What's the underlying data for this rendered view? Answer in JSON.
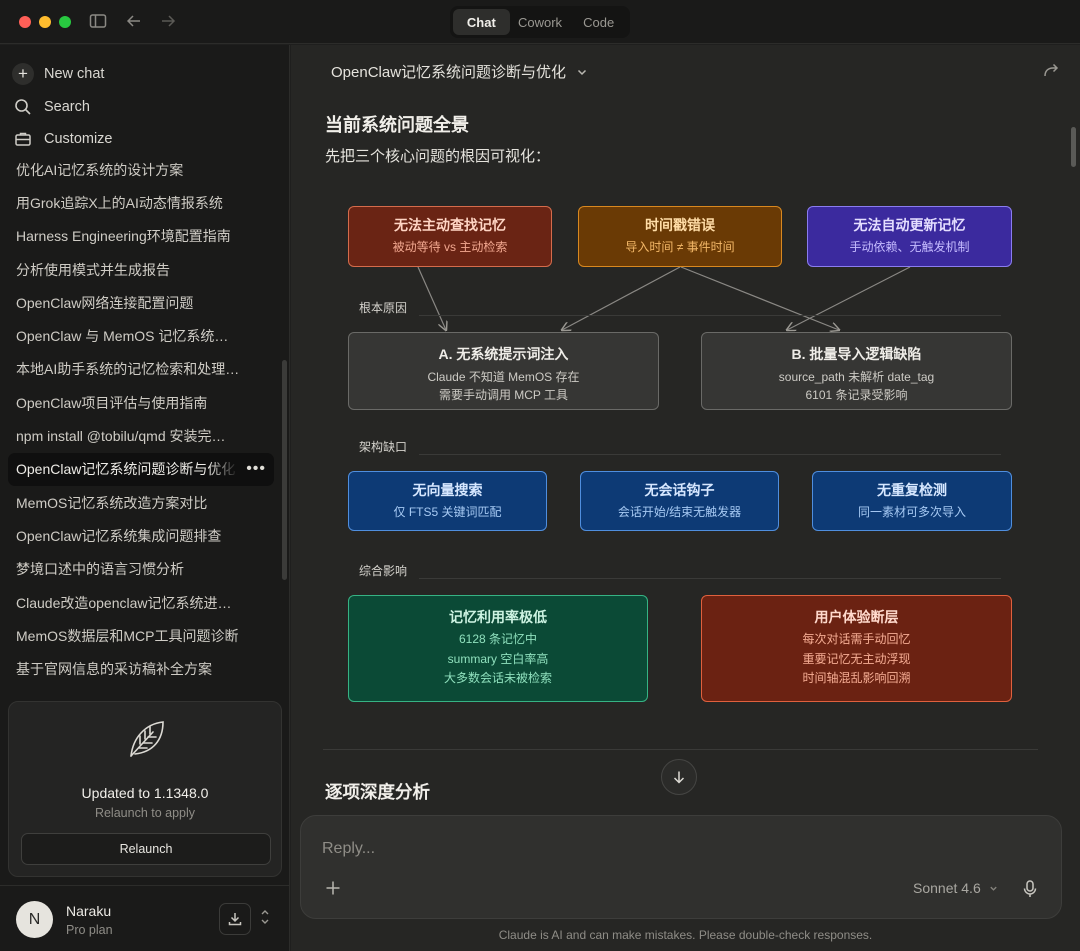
{
  "mode_switch": {
    "tabs": [
      "Chat",
      "Cowork",
      "Code"
    ],
    "active": "Chat"
  },
  "sidebar": {
    "new_chat": "New chat",
    "search": "Search",
    "customize": "Customize",
    "recents": [
      "优化AI记忆系统的设计方案",
      "用Grok追踪X上的AI动态情报系统",
      "Harness Engineering环境配置指南",
      "分析使用模式并生成报告",
      "OpenClaw网络连接配置问题",
      "OpenClaw 与 MemOS 记忆系统…",
      "本地AI助手系统的记忆检索和处理…",
      "OpenClaw项目评估与使用指南",
      "npm install @tobilu/qmd 安装完…",
      "OpenClaw记忆系统问题诊断与优化",
      "MemOS记忆系统改造方案对比",
      "OpenClaw记忆系统集成问题排查",
      "梦境口述中的语言习惯分析",
      "Claude改造openclaw记忆系统进…",
      "MemOS数据层和MCP工具问题诊断",
      "基于官网信息的采访稿补全方案"
    ],
    "active_index": 9,
    "more_glyph": "•••",
    "update": {
      "title": "Updated to 1.1348.0",
      "subtitle": "Relaunch to apply",
      "button": "Relaunch"
    },
    "user": {
      "initial": "N",
      "name": "Naraku",
      "plan": "Pro plan"
    }
  },
  "conversation": {
    "title": "OpenClaw记忆系统问题诊断与优化",
    "heading": "当前系统问题全景",
    "intro": "先把三个核心问题的根因可视化：",
    "diagram": {
      "top": [
        {
          "title": "无法主动查找记忆",
          "sub": "被动等待 vs 主动检索"
        },
        {
          "title": "时间戳错误",
          "sub": "导入时间 ≠ 事件时间"
        },
        {
          "title": "无法自动更新记忆",
          "sub": "手动依赖、无触发机制"
        }
      ],
      "section1": "根本原因",
      "causes": [
        {
          "title": "A. 无系统提示词注入",
          "lines": [
            "Claude 不知道 MemOS 存在",
            "需要手动调用 MCP 工具"
          ]
        },
        {
          "title": "B. 批量导入逻辑缺陷",
          "lines": [
            "source_path 未解析 date_tag",
            "6101 条记录受影响"
          ]
        }
      ],
      "section2": "架构缺口",
      "gaps": [
        {
          "title": "无向量搜索",
          "sub": "仅 FTS5 关键词匹配"
        },
        {
          "title": "无会话钩子",
          "sub": "会话开始/结束无触发器"
        },
        {
          "title": "无重复检测",
          "sub": "同一素材可多次导入"
        }
      ],
      "section3": "综合影响",
      "impacts": [
        {
          "title": "记忆利用率极低",
          "lines": [
            "6128 条记忆中",
            "summary 空白率高",
            "大多数会话未被检索"
          ]
        },
        {
          "title": "用户体验断层",
          "lines": [
            "每次对话需手动回忆",
            "重要记忆无主动浮现",
            "时间轴混乱影响回溯"
          ]
        }
      ]
    },
    "next_heading": "逐项深度分析"
  },
  "composer": {
    "placeholder": "Reply...",
    "model": "Sonnet 4.6"
  },
  "disclaimer": "Claude is AI and can make mistakes. Please double-check responses."
}
